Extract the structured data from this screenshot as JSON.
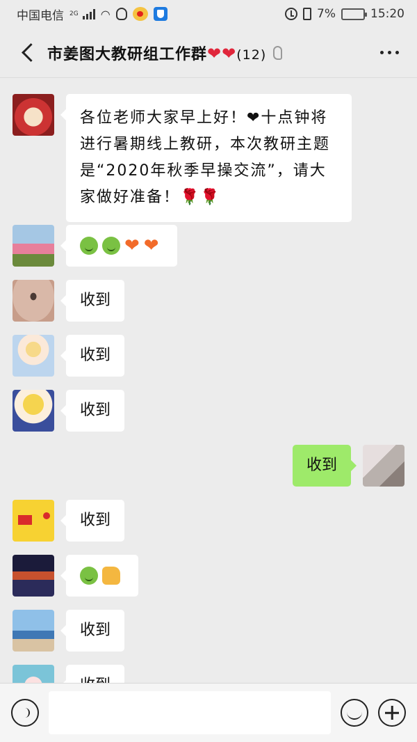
{
  "status_bar": {
    "carrier": "中国电信",
    "network": "2G",
    "battery": "7%",
    "battery_level": 0.07,
    "time": "15:20",
    "icons": [
      "signal-icon",
      "wifi-icon",
      "qq-icon",
      "weibo-icon",
      "shield-icon",
      "alarm-icon",
      "vibrate-icon",
      "battery-icon"
    ]
  },
  "header": {
    "title": "市姜图大教研组工作群",
    "member_count": "(12)",
    "icons": [
      "back-icon",
      "heart-icon",
      "earpiece-icon",
      "more-icon"
    ]
  },
  "messages": [
    {
      "side": "left",
      "text": "各位老师大家早上好！❤十点钟将进行暑期线上教研，本次教研主题是“2020年秋季早操交流”，请大家做好准备！🌹🌹"
    },
    {
      "side": "left",
      "emoji": [
        "smile-emoji",
        "smile-emoji",
        "heart-emoji",
        "heart-emoji"
      ]
    },
    {
      "side": "left",
      "text": "收到"
    },
    {
      "side": "left",
      "text": "收到"
    },
    {
      "side": "left",
      "text": "收到"
    },
    {
      "side": "right",
      "text": "收到"
    },
    {
      "side": "left",
      "text": "收到"
    },
    {
      "side": "left",
      "emoji": [
        "smile-emoji",
        "thumbs-up-emoji"
      ]
    },
    {
      "side": "left",
      "text": "收到"
    },
    {
      "side": "left",
      "text": "收到"
    }
  ],
  "input_bar": {
    "value": "",
    "icons": [
      "voice-icon",
      "emoji-icon",
      "plus-icon"
    ]
  },
  "colors": {
    "background": "#ececec",
    "my_bubble": "#9eea6a",
    "other_bubble": "#ffffff",
    "heart": "#e0263b",
    "battery_low": "#e02020"
  }
}
